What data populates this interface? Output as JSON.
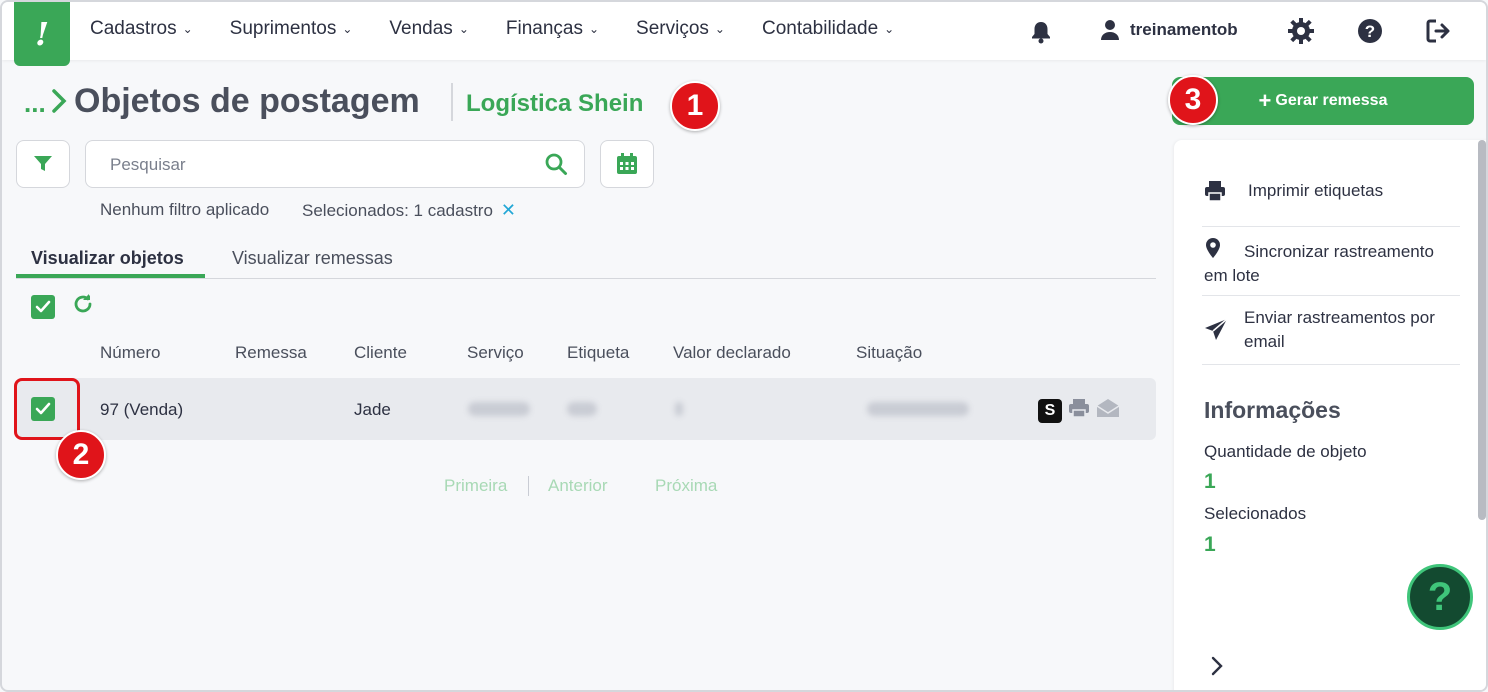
{
  "nav": {
    "logo_text": "!",
    "menu": [
      "Cadastros",
      "Suprimentos",
      "Vendas",
      "Finanças",
      "Serviços",
      "Contabilidade"
    ],
    "username": "treinamentob"
  },
  "header": {
    "breadcrumb_dots": "...",
    "title": "Objetos de postagem",
    "subtitle": "Logística Shein",
    "generate_button": "Gerar remessa"
  },
  "badges": {
    "one": "1",
    "two": "2",
    "three": "3"
  },
  "toolbar": {
    "search_placeholder": "Pesquisar",
    "no_filter": "Nenhum filtro aplicado",
    "selected_text": "Selecionados: 1 cadastro",
    "clear_symbol": "✕"
  },
  "tabs": {
    "objects": "Visualizar objetos",
    "shipments": "Visualizar remessas"
  },
  "table": {
    "columns": [
      "Número",
      "Remessa",
      "Cliente",
      "Serviço",
      "Etiqueta",
      "Valor declarado",
      "Situação"
    ],
    "rows": [
      {
        "numero": "97 (Venda)",
        "remessa": "",
        "cliente": "Jade",
        "s_badge": "S"
      }
    ]
  },
  "pager": {
    "first": "Primeira",
    "prev": "Anterior",
    "next": "Próxima"
  },
  "side": {
    "actions": [
      "Imprimir etiquetas",
      "Sincronizar rastreamento em lote",
      "Enviar rastreamentos por email"
    ],
    "info_title": "Informações",
    "qty_label": "Quantidade de objeto",
    "qty_value": "1",
    "selected_label": "Selecionados",
    "selected_value": "1",
    "help_symbol": "?"
  },
  "colors": {
    "brand": "#3aa757",
    "badge": "#e0141a",
    "text": "#2d3142"
  }
}
